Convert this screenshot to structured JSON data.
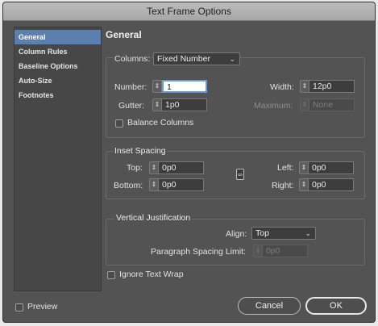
{
  "window": {
    "title": "Text Frame Options"
  },
  "sidebar": {
    "items": [
      {
        "label": "General",
        "selected": true
      },
      {
        "label": "Column Rules",
        "selected": false
      },
      {
        "label": "Baseline Options",
        "selected": false
      },
      {
        "label": "Auto-Size",
        "selected": false
      },
      {
        "label": "Footnotes",
        "selected": false
      }
    ]
  },
  "main": {
    "section_title": "General",
    "columns": {
      "label": "Columns:",
      "value": "Fixed Number",
      "number_label": "Number:",
      "number_value": "1",
      "width_label": "Width:",
      "width_value": "12p0",
      "gutter_label": "Gutter:",
      "gutter_value": "1p0",
      "maximum_label": "Maximum:",
      "maximum_value": "None",
      "balance_label": "Balance Columns",
      "balance_checked": false
    },
    "inset": {
      "title": "Inset Spacing",
      "top_label": "Top:",
      "top_value": "0p0",
      "bottom_label": "Bottom:",
      "bottom_value": "0p0",
      "left_label": "Left:",
      "left_value": "0p0",
      "right_label": "Right:",
      "right_value": "0p0"
    },
    "vertical": {
      "title": "Vertical Justification",
      "align_label": "Align:",
      "align_value": "Top",
      "para_label": "Paragraph Spacing Limit:",
      "para_value": "0p0"
    },
    "ignore_wrap_label": "Ignore Text Wrap",
    "ignore_wrap_checked": false
  },
  "footer": {
    "preview_label": "Preview",
    "preview_checked": false,
    "cancel_label": "Cancel",
    "ok_label": "OK"
  },
  "colors": {
    "accent": "#5b7fae",
    "panel": "#535353"
  },
  "icons": {
    "spinner": "up-down-arrows-icon",
    "link": "chain-link-icon",
    "dropdown": "chevron-down-icon"
  }
}
